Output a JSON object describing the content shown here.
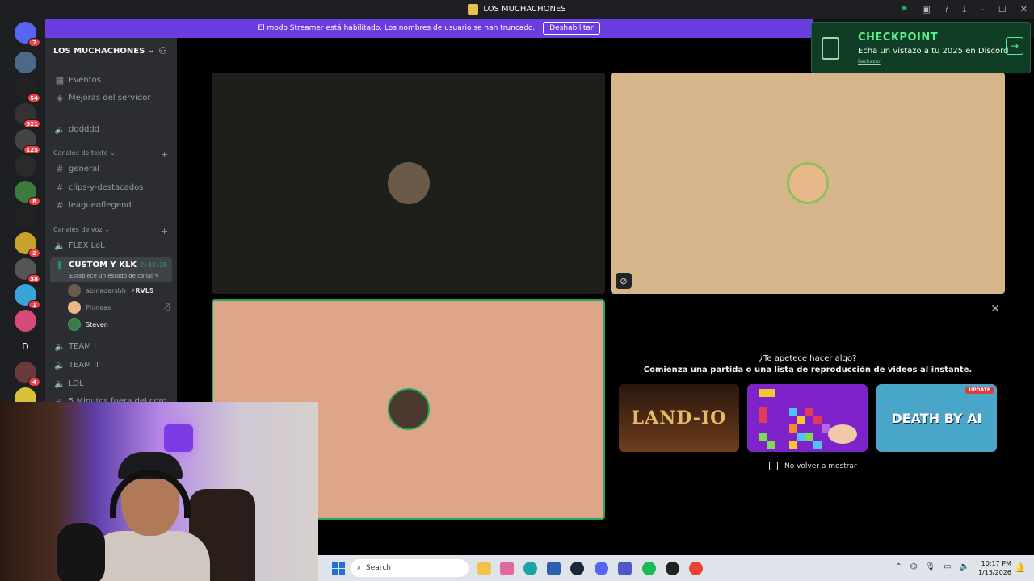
{
  "window": {
    "title": "LOS MUCHACHONES"
  },
  "banner": {
    "text": "El modo Streamer está habilitado. Los nombres de usuario se han truncado.",
    "button": "Deshabilitar"
  },
  "rail": {
    "home_badge": "7",
    "badges": [
      "54",
      "521",
      "125",
      "8",
      "2",
      "38",
      "1",
      "4"
    ],
    "letter_server": "D"
  },
  "sidebar": {
    "server_name": "LOS MUCHACHONES",
    "server_chevron": "⌄",
    "top_items": [
      "Eventos",
      "Mejoras del servidor"
    ],
    "lone_voice": "dddddd",
    "text_category": "Canales de texto",
    "text_channels": [
      "general",
      "clips-y-destacados",
      "leagueoflegend"
    ],
    "voice_category": "Canales de voz",
    "voice_channels_before": [
      "FLEX LoL"
    ],
    "active_channel": {
      "name": "CUSTOM Y KLK",
      "timer": "2:43:30",
      "status": "Establece un estado de canal"
    },
    "voice_users": [
      {
        "name": "abinadershh",
        "tag": "⚡RVLS"
      },
      {
        "name": "Phineas"
      },
      {
        "name": "Steven"
      }
    ],
    "voice_channels_after": [
      "TEAM I",
      "TEAM II",
      "LOL",
      "5 Minutos fuera del coro"
    ]
  },
  "activity": {
    "question": "¿Te apetece hacer algo?",
    "subtitle": "Comienza una partida o una lista de reproducción de videos al instante.",
    "cards": [
      {
        "name": "LAND-IO"
      },
      {
        "name": ""
      },
      {
        "name": "DEATH BY AI",
        "badge": "UPDATE"
      }
    ],
    "dont_show": "No volver a mostrar"
  },
  "toast": {
    "heading": "CHECKPOINT",
    "subtitle": "Echa un vistazo a tu 2025 en Discord",
    "dismiss": "Rechazar"
  },
  "taskbar": {
    "search_placeholder": "Search",
    "time": "10:17 PM",
    "date": "1/15/2026"
  },
  "colors": {
    "streamer_banner": "#6b3de0",
    "speaking_border": "#23a55a",
    "checkpoint_green": "#5af08c"
  }
}
